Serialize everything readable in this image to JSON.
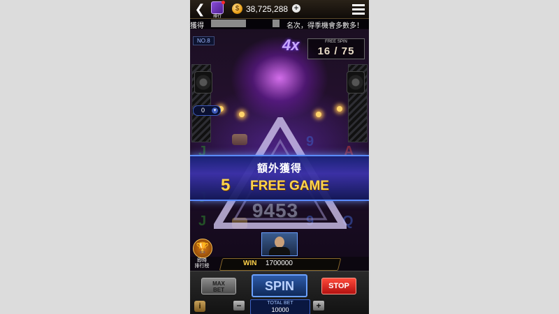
{
  "topbar": {
    "rank_label": "排行",
    "coin_symbol": "$",
    "coins": "38,725,288",
    "plus": "+"
  },
  "marquee": {
    "left_text": "獲得",
    "right_text": "名次，得季機會多數多！"
  },
  "machine_no": "NO.8",
  "multiplier": "4x",
  "free_spin": {
    "title": "FREE SPIN",
    "count": "16 / 75"
  },
  "bet_select": {
    "value": "0"
  },
  "banner": {
    "title": "額外獲得",
    "number": "5",
    "text": "FREE GAME"
  },
  "big_number": "9453",
  "leaderboard": {
    "line1": "即時",
    "line2": "排行榜"
  },
  "win": {
    "label": "WIN",
    "amount": "1700000"
  },
  "controls": {
    "maxbet_line1": "MAX",
    "maxbet_line2": "BET",
    "spin": "SPIN",
    "stop": "STOP",
    "info": "i",
    "minus": "−",
    "plus": "+",
    "total_bet_label": "TOTAL BET",
    "total_bet_value": "10000"
  },
  "reel_symbols": [
    "J",
    "A",
    "9",
    "J",
    "9",
    "Q",
    "Q",
    "J",
    "9"
  ],
  "colors": {
    "accent_gold": "#ffd44d",
    "banner_blue": "#3c32aa",
    "spin_blue": "#2d5aa8",
    "stop_red": "#e02020"
  }
}
